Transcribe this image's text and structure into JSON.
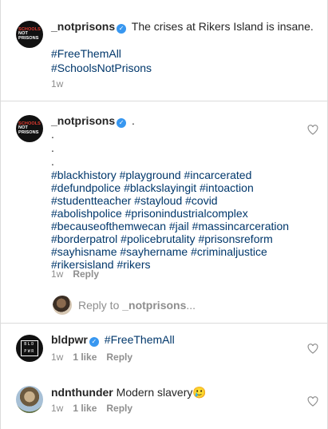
{
  "caption": {
    "username": "_notprisons",
    "text": "The crises at Rikers Island is insane.",
    "hashtags": [
      "#FreeThemAll",
      "#SchoolsNotPrisons"
    ],
    "time": "1w",
    "avatar_logo": [
      "SCHOOLS",
      "NOT",
      "PRISONS"
    ]
  },
  "comment1": {
    "username": "_notprisons",
    "text": ".",
    "dots": [
      ".",
      ".",
      "."
    ],
    "hashtag_lines": [
      "#blackhistory #playground #incarcerated",
      "#defundpolice #blackslayingit #intoaction",
      "#studentteacher  #stayloud #covid",
      "#abolishpolice #prisonindustrialcomplex",
      "#becauseofthemwecan #jail #massincarceration",
      "#borderpatrol #policebrutality #prisonsreform",
      "#sayhisname #sayhername #criminaljustice",
      "#rikersisland #rikers"
    ],
    "time": "1w",
    "reply_label": "Reply"
  },
  "reply_prompt": {
    "prefix": "Reply to ",
    "target": "_notprisons",
    "suffix": "..."
  },
  "comment2": {
    "username": "bldpwr",
    "text": "#FreeThemAll",
    "time": "1w",
    "likes": "1 like",
    "reply_label": "Reply",
    "avatar_logo": [
      "BLD",
      "PWR"
    ]
  },
  "comment3": {
    "username": "ndnthunder",
    "text": "Modern slavery",
    "emoji": "🥲",
    "time": "1w",
    "likes": "1 like",
    "reply_label": "Reply"
  },
  "icons": {
    "verified": "verified-badge-icon",
    "like": "heart-outline-icon"
  },
  "colors": {
    "verified": "#3897f0",
    "hashtag": "#00376b",
    "muted": "#8e8e8e",
    "divider": "#dbdbdb"
  }
}
